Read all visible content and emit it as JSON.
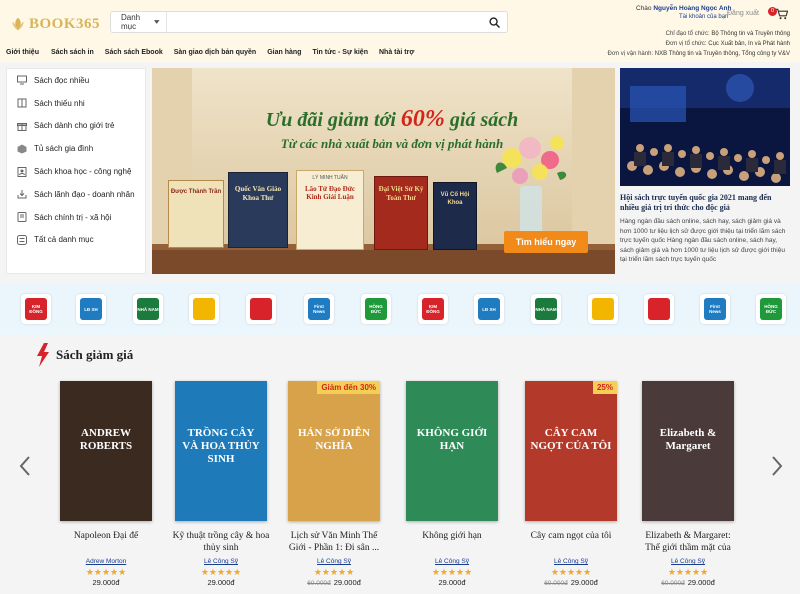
{
  "brand": {
    "name": "BOOK365",
    "accent": "#d9b45a"
  },
  "search": {
    "category": "Danh mục",
    "placeholder": ""
  },
  "user": {
    "greeting": "Chào",
    "name": "Nguyễn Hoàng Ngọc Anh",
    "account_link": "Tài khoản của bạn",
    "logout": "Đăng xuất",
    "cart_count": "0"
  },
  "nav": [
    "Giới thiệu",
    "Sách sách in",
    "Sách sách Ebook",
    "Sàn giao dịch bản quyền",
    "Gian hàng",
    "Tin tức - Sự kiện",
    "Nhà tài trợ"
  ],
  "info": [
    {
      "label": "Chỉ đạo tổ chức:",
      "value": "Bộ Thông tin và Truyền thông"
    },
    {
      "label": "Đơn vị tổ chức:",
      "value": "Cục Xuất bản, In và Phát hành"
    },
    {
      "label": "Đơn vị vận hành:",
      "value": "NXB Thông tin và Truyền thông, Tổng công ty V&V"
    }
  ],
  "sidebar": [
    {
      "label": "Sách đọc nhiều",
      "icon": "monitor-icon"
    },
    {
      "label": "Sách thiếu nhi",
      "icon": "book-icon"
    },
    {
      "label": "Sách dành cho giới trẻ",
      "icon": "gift-icon"
    },
    {
      "label": "Tủ sách gia đình",
      "icon": "cube-icon"
    },
    {
      "label": "Sách khoa học - công nghệ",
      "icon": "user-icon"
    },
    {
      "label": "Sách lãnh đạo - doanh nhân",
      "icon": "download-icon"
    },
    {
      "label": "Sách chính trị - xã hội",
      "icon": "tablet-icon"
    },
    {
      "label": "Tất cả danh mục",
      "icon": "list-icon"
    }
  ],
  "banner": {
    "headline_pre": "Ưu đãi giảm tới",
    "headline_pct": "60%",
    "headline_post": "giá sách",
    "subline": "Từ các nhà xuất bản và đơn vị phát hành",
    "cta": "Tìm hiểu ngay",
    "books": [
      "Được Thành Trần",
      "Quốc Văn Giáo Khoa Thư",
      "Lão Tử Đạo Đức Kinh Giải Luận",
      "Đại Việt Sử Ký Toàn Thư",
      "Vũ Cố Hội Khoa"
    ],
    "book_author": "LÝ MINH TUẤN"
  },
  "news": {
    "title": "Hội sách trực tuyến quốc gia 2021 mang đến nhiều giá trị tri thức cho độc giả",
    "desc": "Hàng ngàn đầu sách online, sách hay, sách giảm giá và hơn 1000 tư liệu lịch sử được giới thiệu tại triển lãm sách trực tuyến quốc Hàng ngàn đầu sách online, sách hay, sách giảm giá và hơn 1000 tư liệu lịch sử được giới thiệu tại triển lãm sách trực tuyến quốc"
  },
  "publishers": [
    {
      "logo": "KIM ĐỒNG",
      "color": "#d8232a"
    },
    {
      "logo": "LĐ XH",
      "color": "#1f7cc1"
    },
    {
      "logo": "NHÃ NAM",
      "color": "#1a7b3c"
    },
    {
      "logo": "",
      "color": "#f2b600"
    },
    {
      "logo": "",
      "color": "#d8232a"
    },
    {
      "logo": "First News",
      "color": "#1f7cc1"
    },
    {
      "logo": "HỒNG ĐỨC",
      "color": "#1f9a3a"
    },
    {
      "logo": "KIM ĐỒNG",
      "color": "#d8232a"
    },
    {
      "logo": "LĐ XH",
      "color": "#1f7cc1"
    },
    {
      "logo": "NHÃ NAM",
      "color": "#1a7b3c"
    },
    {
      "logo": "",
      "color": "#f2b600"
    },
    {
      "logo": "",
      "color": "#d8232a"
    },
    {
      "logo": "First News",
      "color": "#1f7cc1"
    },
    {
      "logo": "HỒNG ĐỨC",
      "color": "#1f9a3a"
    }
  ],
  "sale": {
    "title": "Sách giảm giá",
    "stars": "★★★★★",
    "books": [
      {
        "title": "Napoleon Đại đế",
        "author": "Adrew Morton",
        "old_price": "",
        "price": "29.000đ",
        "badge": "",
        "cover_text": "ANDREW ROBERTS",
        "cover_bg": "#3a2a20"
      },
      {
        "title": "Kỹ thuật trồng cây & hoa thủy sinh",
        "author": "Lê Công Sỹ",
        "old_price": "",
        "price": "29.000đ",
        "badge": "",
        "cover_text": "TRỒNG CÂY VÀ HOA THỦY SINH",
        "cover_bg": "#1e7ab8"
      },
      {
        "title": "Lịch sử Văn Minh Thế Giới - Phần 1: Đi sân ...",
        "author": "Lê Công Sỹ",
        "old_price": "60.000đ",
        "price": "29.000đ",
        "badge": "Giảm đến 30%",
        "cover_text": "HÁN SỞ DIỄN NGHĨA",
        "cover_bg": "#d8a24a"
      },
      {
        "title": "Không giới hạn",
        "author": "Lê Công Sỹ",
        "old_price": "",
        "price": "29.000đ",
        "badge": "",
        "cover_text": "KHÔNG GIỚI HẠN",
        "cover_bg": "#2e8b57"
      },
      {
        "title": "Cây cam ngọt của tôi",
        "author": "Lê Công Sỹ",
        "old_price": "60.000đ",
        "price": "29.000đ",
        "badge": "25%",
        "cover_text": "CÂY CAM NGỌT CỦA TÔI",
        "cover_bg": "#b33a2a"
      },
      {
        "title": "Elizabeth & Margaret: Thế giới thầm mặt của",
        "author": "Lê Công Sỹ",
        "old_price": "60.000đ",
        "price": "29.000đ",
        "badge": "",
        "cover_text": "Elizabeth & Margaret",
        "cover_bg": "#4a3a3a"
      }
    ]
  }
}
